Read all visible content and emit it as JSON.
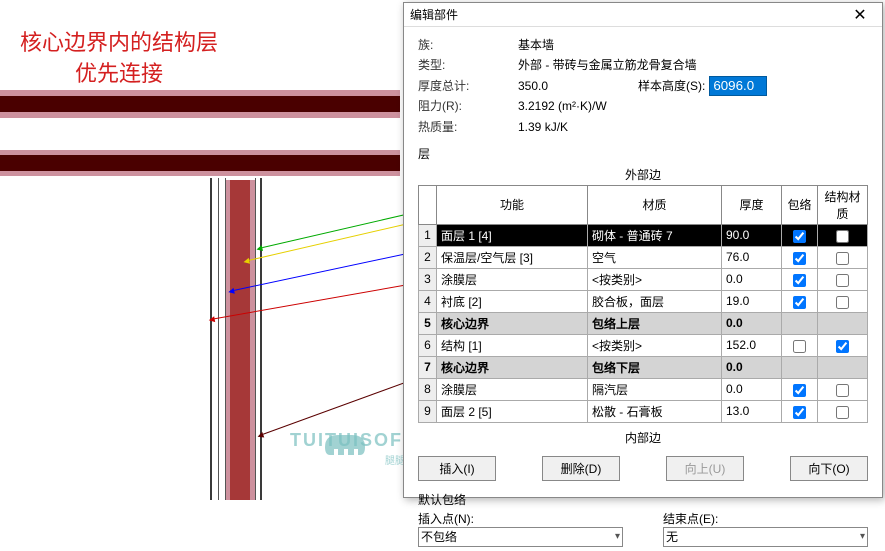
{
  "annotation": {
    "line1": "核心边界内的结构层",
    "line2": "优先连接"
  },
  "dialog": {
    "title": "编辑部件",
    "close": "✕",
    "props": {
      "family_label": "族:",
      "family": "基本墙",
      "type_label": "类型:",
      "type": "外部 - 带砖与金属立筋龙骨复合墙",
      "thickness_label": "厚度总计:",
      "thickness": "350.0",
      "sample_h_label": "样本高度(S):",
      "sample_h": "6096.0",
      "resistance_label": "阻力(R):",
      "resistance": "3.2192 (m²·K)/W",
      "thermal_label": "热质量:",
      "thermal": "1.39 kJ/K"
    },
    "layers_title": "层",
    "outer": "外部边",
    "inner": "内部边",
    "headers": {
      "func": "功能",
      "mat": "材质",
      "thick": "厚度",
      "wrap": "包络",
      "struct": "结构材质"
    },
    "rows": [
      {
        "i": "1",
        "func": "面层 1 [4]",
        "mat": "砌体 - 普通砖 7",
        "thick": "90.0",
        "wrap": true,
        "struct": false,
        "sel": true
      },
      {
        "i": "2",
        "func": "保温层/空气层 [3]",
        "mat": "空气",
        "thick": "76.0",
        "wrap": true,
        "struct": false
      },
      {
        "i": "3",
        "func": "涂膜层",
        "mat": "<按类别>",
        "thick": "0.0",
        "wrap": true,
        "struct": false
      },
      {
        "i": "4",
        "func": "衬底 [2]",
        "mat": "胶合板，面层",
        "thick": "19.0",
        "wrap": true,
        "struct": false
      },
      {
        "i": "5",
        "func": "核心边界",
        "mat": "包络上层",
        "thick": "0.0",
        "core": true
      },
      {
        "i": "6",
        "func": "结构 [1]",
        "mat": "<按类别>",
        "thick": "152.0",
        "wrap": false,
        "struct": true
      },
      {
        "i": "7",
        "func": "核心边界",
        "mat": "包络下层",
        "thick": "0.0",
        "core": true
      },
      {
        "i": "8",
        "func": "涂膜层",
        "mat": "隔汽层",
        "thick": "0.0",
        "wrap": true,
        "struct": false
      },
      {
        "i": "9",
        "func": "面层 2 [5]",
        "mat": "松散 - 石膏板",
        "thick": "13.0",
        "wrap": true,
        "struct": false
      }
    ],
    "btns": {
      "insert": "插入(I)",
      "delete": "删除(D)",
      "up": "向上(U)",
      "down": "向下(O)"
    },
    "wrap": {
      "title": "默认包络",
      "insert_label": "插入点(N):",
      "insert_val": "不包络",
      "end_label": "结束点(E):",
      "end_val": "无"
    }
  },
  "watermark": {
    "main": "TUITUISOFT",
    "sub": "腿腿教学网"
  }
}
